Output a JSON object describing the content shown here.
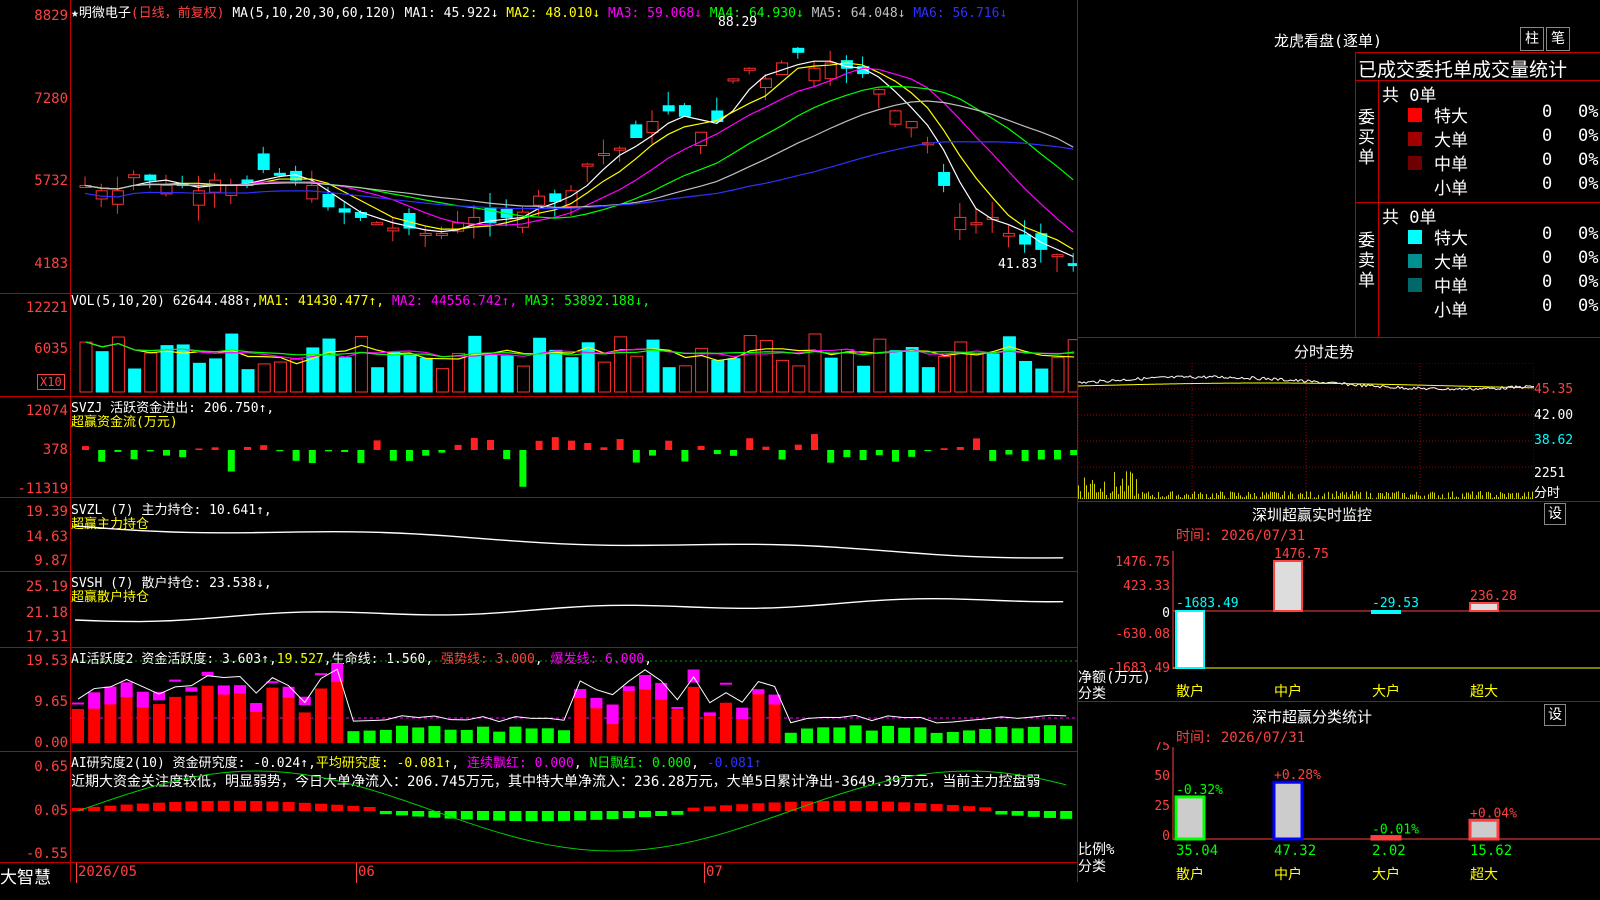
{
  "main": {
    "title": "★明微电子",
    "mode": "(日线，前复权)",
    "ma_text": "MA(5,10,20,30,60,120)",
    "ma": [
      {
        "label": "MA1:",
        "value": "45.922↓",
        "color": "#ffffff"
      },
      {
        "label": "MA2:",
        "value": "48.010↓",
        "color": "#ffff00"
      },
      {
        "label": "MA3:",
        "value": "59.068↓",
        "color": "#ff00ff"
      },
      {
        "label": "MA4:",
        "value": "64.930↓",
        "color": "#00ff00"
      },
      {
        "label": "MA5:",
        "value": "64.048↓",
        "color": "#c0c0c0"
      },
      {
        "label": "MA6:",
        "value": "56.716↓",
        "color": "#3030ff"
      }
    ],
    "yticks": [
      "8829",
      "7280",
      "5732",
      "4183"
    ],
    "high_label": "88.29",
    "low_label": "41.83"
  },
  "vol": {
    "name": "VOL(5,10,20)",
    "value": "62644.488↑",
    "ma": [
      {
        "label": "MA1:",
        "value": "41430.477↑",
        "color": "#ffff00"
      },
      {
        "label": "MA2:",
        "value": "44556.742↑",
        "color": "#ff00ff"
      },
      {
        "label": "MA3:",
        "value": "53892.188↓",
        "color": "#00ff00"
      }
    ],
    "yticks": [
      "12221",
      "6035"
    ],
    "unit": "X10"
  },
  "svzj": {
    "name": "SVZJ",
    "label": "活跃资金进出:",
    "value": "206.750↑",
    "sub": "超赢资金流(万元)",
    "yticks": [
      "12074",
      "378",
      "-11319"
    ]
  },
  "svzl": {
    "name": "SVZL (7)",
    "label": "主力持仓:",
    "value": "10.641↑",
    "sub": "超赢主力持仓",
    "yticks": [
      "19.39",
      "14.63",
      "9.87"
    ]
  },
  "svsh": {
    "name": "SVSH (7)",
    "label": "散户持仓:",
    "value": "23.538↓",
    "sub": "超赢散户持仓",
    "yticks": [
      "25.19",
      "21.18",
      "17.31"
    ]
  },
  "ai1": {
    "name": "AI活跃度2",
    "label1": "资金活跃度:",
    "v1": "3.603↑",
    "v2": "19.527",
    "label3": "生命线:",
    "v3": "1.560",
    "label4": "强势线:",
    "v4": "3.000",
    "label5": "爆发线:",
    "v5": "6.000",
    "yticks": [
      "19.53",
      "9.65",
      "0.00"
    ]
  },
  "ai2": {
    "name": "AI研究度2(10)",
    "label1": "资金研究度:",
    "v1": "-0.024↑",
    "label2": "平均研究度:",
    "v2": "-0.081↑",
    "label3": "连续飘红:",
    "v3": "0.000",
    "label4": "N日飘红:",
    "v4": "0.000",
    "v5": "-0.081↑",
    "comment": "近期大资金关注度较低，明显弱势，今日大单净流入：206.745万元，其中特大单净流入：236.28万元，大单5日累计净出-3649.39万元，当前主力控盘弱",
    "yticks": [
      "0.65",
      "0.05",
      "-0.55"
    ]
  },
  "dates": [
    "2026/05",
    "06",
    "07"
  ],
  "logo": "大智慧",
  "right": {
    "lhb_title": "龙虎看盘(逐单)",
    "btn_zhu": "柱",
    "btn_bi": "笔",
    "stat_title": "已成交委托单成交量统计",
    "buy_label": "委买单",
    "sell_label": "委卖单",
    "buy_count": "共 0单",
    "sell_count": "共 0单",
    "buy_rows": [
      {
        "name": "特大",
        "v": "0",
        "p": "0%",
        "c": "#ff0000"
      },
      {
        "name": "大单",
        "v": "0",
        "p": "0%",
        "c": "#a00000"
      },
      {
        "name": "中单",
        "v": "0",
        "p": "0%",
        "c": "#700000"
      },
      {
        "name": "小单",
        "v": "0",
        "p": "0%",
        "c": "#000000"
      }
    ],
    "sell_rows": [
      {
        "name": "特大",
        "v": "0",
        "p": "0%",
        "c": "#00ffff"
      },
      {
        "name": "大单",
        "v": "0",
        "p": "0%",
        "c": "#009090"
      },
      {
        "name": "中单",
        "v": "0",
        "p": "0%",
        "c": "#006868"
      },
      {
        "name": "小单",
        "v": "0",
        "p": "0%",
        "c": "#000000"
      }
    ],
    "fs_title": "分时走势",
    "fs_ticks": [
      "45.35",
      "42.00",
      "38.62",
      "2251"
    ],
    "fs_unit": "分时",
    "mon_title": "深圳超赢实时监控",
    "set1": "设",
    "time_label": "时间:",
    "time_value": "2026/07/31",
    "mon_yticks": [
      "1476.75",
      "423.33",
      "0",
      "-630.08",
      "-1683.49"
    ],
    "mon_unit": "净额(万元)",
    "mon_cat": "分类",
    "mon_values": [
      {
        "cat": "散户",
        "v": "-1683.49",
        "c": "#00ffff"
      },
      {
        "cat": "中户",
        "v": "1476.75",
        "c": "#ff4040"
      },
      {
        "cat": "大户",
        "v": "-29.53",
        "c": "#00ffff"
      },
      {
        "cat": "超大",
        "v": "236.28",
        "c": "#ff4040"
      }
    ],
    "cls_title": "深市超赢分类统计",
    "set2": "设",
    "cls_yticks": [
      "75",
      "50",
      "25",
      "0"
    ],
    "cls_unit": "比例%",
    "cls_cat": "分类",
    "cls_values": [
      {
        "cat": "散户",
        "v": "35.04",
        "d": "-0.32%"
      },
      {
        "cat": "中户",
        "v": "47.32",
        "d": "+0.28%"
      },
      {
        "cat": "大户",
        "v": "2.02",
        "d": "-0.01%"
      },
      {
        "cat": "超大",
        "v": "15.62",
        "d": "+0.04%"
      }
    ]
  }
}
